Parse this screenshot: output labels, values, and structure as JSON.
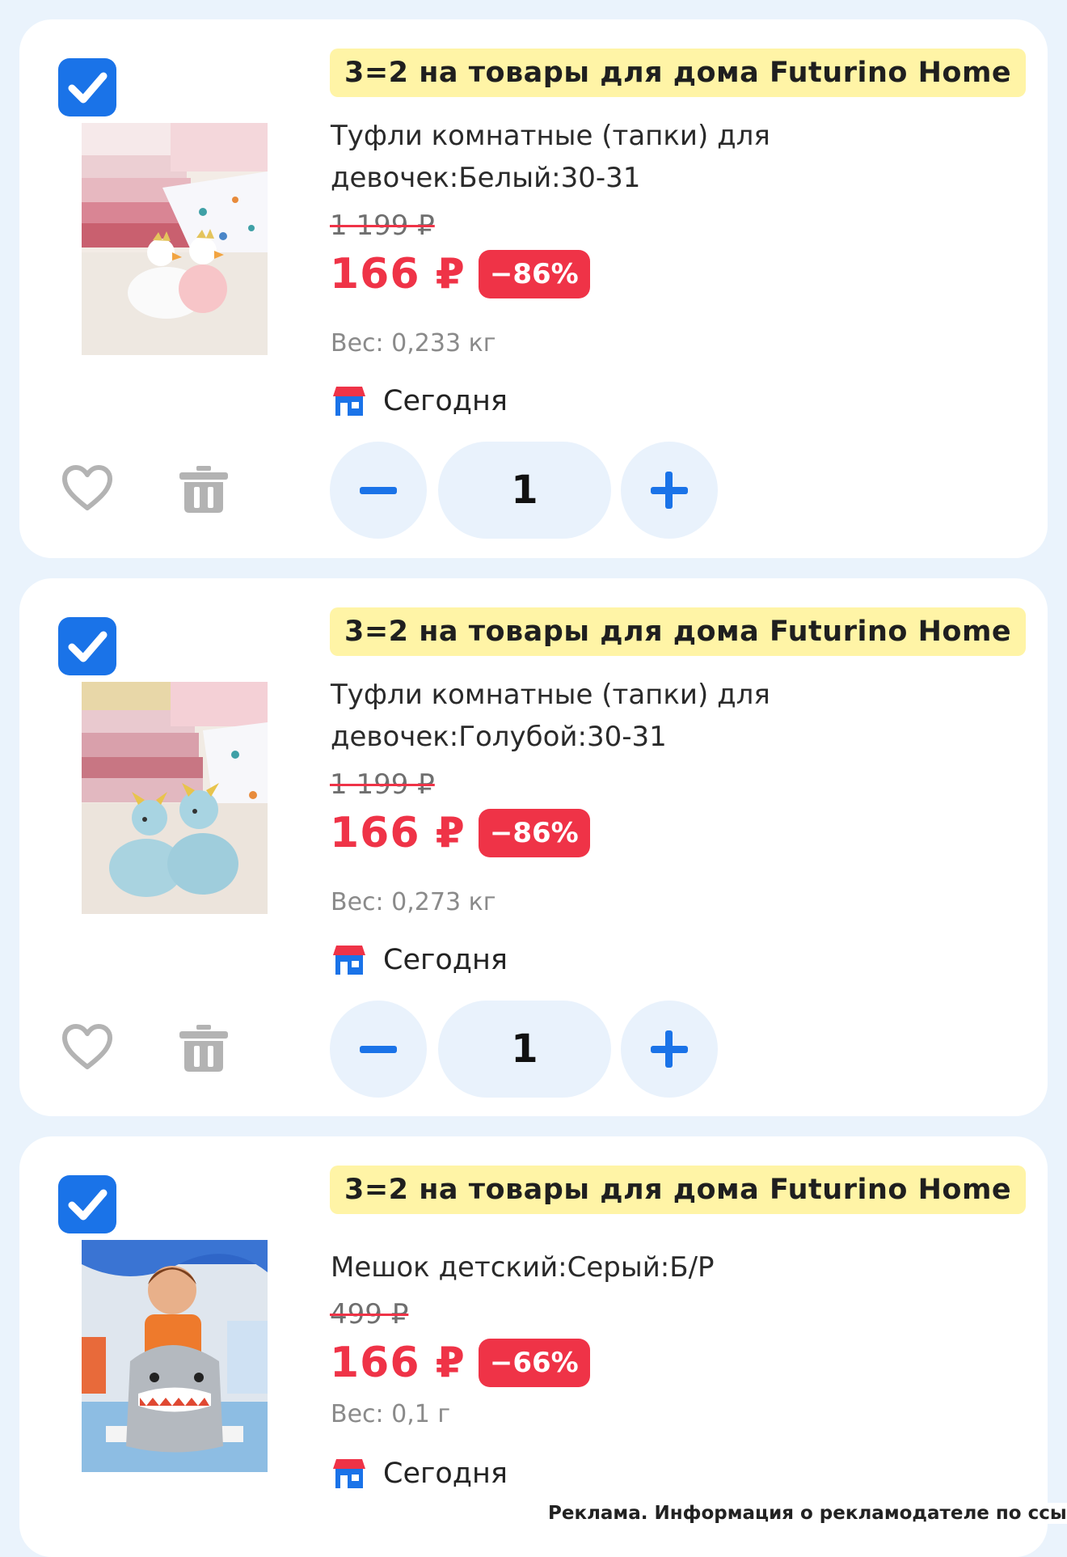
{
  "colors": {
    "accent": "#1a73e8",
    "price": "#ef3347",
    "promo_bg": "#fff4a6",
    "page_bg": "#eaf3fc"
  },
  "items": [
    {
      "promo": "3=2 на товары для дома Futurino Home",
      "title": "Туфли комнатные (тапки) для девочек:Белый:30-31",
      "old_price": "1 199 ₽",
      "price": "166 ₽",
      "discount": "−86%",
      "weight": "Вес: 0,233 кг",
      "delivery": "Сегодня",
      "quantity": "1",
      "checked": true
    },
    {
      "promo": "3=2 на товары для дома Futurino Home",
      "title": "Туфли комнатные (тапки) для девочек:Голубой:30-31",
      "old_price": "1 199 ₽",
      "price": "166 ₽",
      "discount": "−86%",
      "weight": "Вес: 0,273 кг",
      "delivery": "Сегодня",
      "quantity": "1",
      "checked": true
    },
    {
      "promo": "3=2 на товары для дома Futurino Home",
      "title": "Мешок детский:Серый:Б/Р",
      "old_price": "499 ₽",
      "price": "166 ₽",
      "discount": "−66%",
      "weight": "Вес: 0,1 г",
      "delivery": "Сегодня",
      "checked": true
    }
  ],
  "icons": [
    "check-icon",
    "heart-icon",
    "trash-icon",
    "minus-icon",
    "plus-icon",
    "store-icon"
  ],
  "ad_note": "Реклама. Информация о рекламодателе по ссылке"
}
